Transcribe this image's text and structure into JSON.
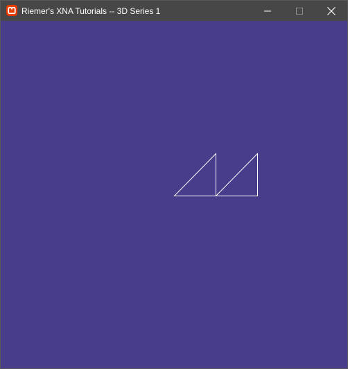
{
  "window": {
    "title": "Riemer's XNA Tutorials -- 3D Series 1",
    "app_icon": "monogame-logo-icon",
    "controls": {
      "minimize_icon": "minimize-icon",
      "maximize_icon": "maximize-icon",
      "close_icon": "close-icon"
    }
  },
  "colors": {
    "titlebar": "#474747",
    "title_text": "#ffffff",
    "viewport_background": "#483d8b",
    "wireframe_lines": "#ffffff",
    "app_icon": "#e73c00"
  },
  "scene": {
    "render_mode": "wireframe",
    "shape_icon": "triangle-outline"
  }
}
